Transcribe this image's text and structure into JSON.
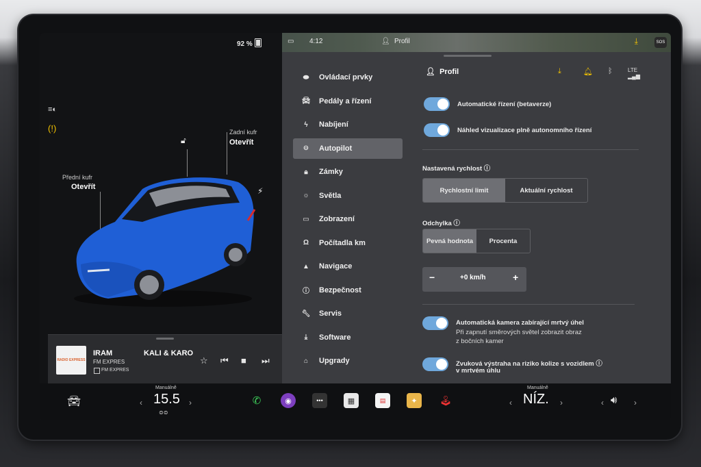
{
  "status": {
    "battery": "92 %"
  },
  "car": {
    "front_trunk_label": "Přední kufr",
    "front_trunk_action": "Otevřít",
    "rear_trunk_label": "Zadní kufr",
    "rear_trunk_action": "Otevřít",
    "body_color": "#1f5fd6"
  },
  "media": {
    "station_logo": "RADIO EXPRESS",
    "title": "IRAM",
    "station": "FM EXPRES",
    "station_sub": "FM EXPRES",
    "artist": "KALI & KARO"
  },
  "topbar": {
    "time_partial": "4:12",
    "profile": "Profil"
  },
  "nav": {
    "items": [
      {
        "label": "Ovládací prvky",
        "icon": "toggle-icon"
      },
      {
        "label": "Pedály a řízení",
        "icon": "car-icon"
      },
      {
        "label": "Nabíjení",
        "icon": "bolt-icon"
      },
      {
        "label": "Autopilot",
        "icon": "steering-wheel-icon",
        "active": true
      },
      {
        "label": "Zámky",
        "icon": "lock-icon"
      },
      {
        "label": "Světla",
        "icon": "sun-icon"
      },
      {
        "label": "Zobrazení",
        "icon": "display-icon"
      },
      {
        "label": "Počítadla km",
        "icon": "odometer-icon"
      },
      {
        "label": "Navigace",
        "icon": "navigation-icon"
      },
      {
        "label": "Bezpečnost",
        "icon": "safety-icon"
      },
      {
        "label": "Servis",
        "icon": "wrench-icon"
      },
      {
        "label": "Software",
        "icon": "download-icon"
      },
      {
        "label": "Upgrady",
        "icon": "bag-icon"
      }
    ]
  },
  "content": {
    "header_profile": "Profil",
    "lte": "LTE",
    "toggle1": "Automatické řízení (betaverze)",
    "toggle2": "Náhled vizualizace plně autonomního řízení",
    "speed_section": "Nastavená rychlost",
    "speed_opt1": "Rychlostní limit",
    "speed_opt2": "Aktuální rychlost",
    "offset_section": "Odchylka",
    "offset_opt1": "Pevná hodnota",
    "offset_opt2": "Procenta",
    "stepper_minus": "−",
    "stepper_value": "+0 km/h",
    "stepper_plus": "+",
    "toggle3": "Automatická kamera zabírající mrtvý úhel",
    "toggle3_desc1": "Při zapnutí směrových světel zobrazit obraz",
    "toggle3_desc2": "z bočních kamer",
    "toggle4_line1": "Zvuková výstraha na riziko kolize s vozidlem",
    "toggle4_line2": "v mrtvém úhlu"
  },
  "bottom": {
    "left_mode": "Manuálně",
    "temp_left": "15.5",
    "right_mode": "Manuálně",
    "fan_level": "NÍZ.",
    "prev": "‹",
    "next": "›"
  },
  "colors": {
    "accent_blue": "#6fa8dc",
    "warning_yellow": "#f2c200"
  }
}
